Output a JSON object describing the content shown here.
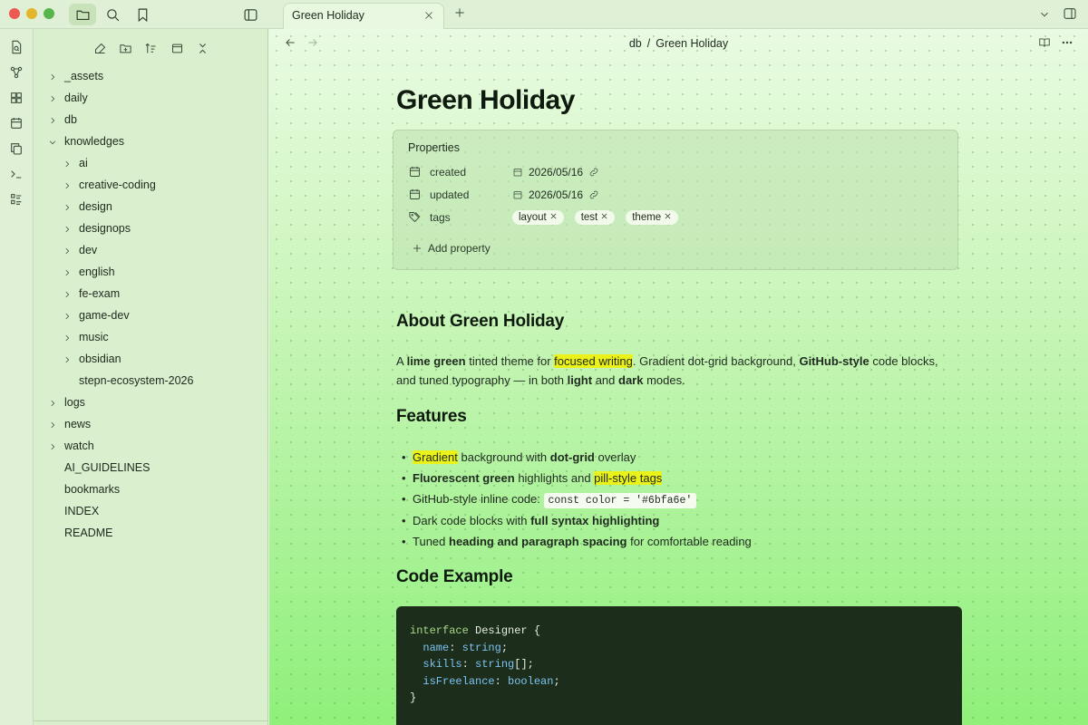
{
  "window": {
    "traffic": [
      "#ee5a52",
      "#e3b52a",
      "#58b54b"
    ]
  },
  "tab": {
    "title": "Green Holiday"
  },
  "breadcrumb": {
    "folder": "db",
    "sep": "/",
    "note": "Green Holiday"
  },
  "tree": {
    "top": [
      {
        "label": "_assets",
        "folder": true
      },
      {
        "label": "daily",
        "folder": true
      },
      {
        "label": "db",
        "folder": true
      },
      {
        "label": "knowledges",
        "folder": true,
        "expanded": true
      }
    ],
    "children": [
      {
        "label": "ai",
        "folder": true
      },
      {
        "label": "creative-coding",
        "folder": true
      },
      {
        "label": "design",
        "folder": true
      },
      {
        "label": "designops",
        "folder": true
      },
      {
        "label": "dev",
        "folder": true
      },
      {
        "label": "english",
        "folder": true
      },
      {
        "label": "fe-exam",
        "folder": true
      },
      {
        "label": "game-dev",
        "folder": true
      },
      {
        "label": "music",
        "folder": true
      },
      {
        "label": "obsidian",
        "folder": true
      },
      {
        "label": "stepn-ecosystem-2026",
        "folder": false
      }
    ],
    "bottom": [
      {
        "label": "logs",
        "folder": true
      },
      {
        "label": "news",
        "folder": true
      },
      {
        "label": "watch",
        "folder": true
      },
      {
        "label": "AI_GUIDELINES",
        "folder": false
      },
      {
        "label": "bookmarks",
        "folder": false
      },
      {
        "label": "INDEX",
        "folder": false
      },
      {
        "label": "README",
        "folder": false
      }
    ]
  },
  "note": {
    "title": "Green Holiday",
    "properties": {
      "label": "Properties",
      "created": {
        "key": "created",
        "value": "2026/05/16"
      },
      "updated": {
        "key": "updated",
        "value": "2026/05/16"
      },
      "tags": {
        "key": "tags",
        "items": [
          "layout",
          "test",
          "theme"
        ]
      },
      "add": "Add property"
    },
    "about": {
      "heading": "About Green Holiday",
      "p1": "A ",
      "b1": "lime green",
      "p2": " tinted theme for ",
      "h1": "focused writing",
      "p3": ". Gradient dot-grid background, ",
      "b2": "GitHub-style",
      "p4": " code blocks, and tuned typography — in both ",
      "b3": "light",
      "p5": " and ",
      "b4": "dark",
      "p6": " modes."
    },
    "features": {
      "heading": "Features",
      "l1": {
        "a": "Gradient",
        "b": " background with ",
        "c": "dot-grid",
        "d": " overlay"
      },
      "l2": {
        "a": "Fluorescent green",
        "b": " highlights and ",
        "c": "pill-style tags"
      },
      "l3": {
        "a": "GitHub-style inline code: ",
        "code": "const color = '#6bfa6e'"
      },
      "l4": {
        "a": "Dark code blocks with ",
        "b": "full syntax highlighting"
      },
      "l5": {
        "a": "Tuned ",
        "b": "heading and paragraph spacing",
        "c": " for comfortable reading"
      }
    },
    "code": {
      "heading": "Code Example",
      "kw_interface": "interface",
      "name": "Designer",
      "open": " {",
      "f1": "name",
      "t1": "string",
      "s1": ";",
      "f2": "skills",
      "t2": "string",
      "s2": "[];",
      "f3": "isFreelance",
      "t3": "boolean",
      "s3": ";",
      "close": "}"
    }
  }
}
